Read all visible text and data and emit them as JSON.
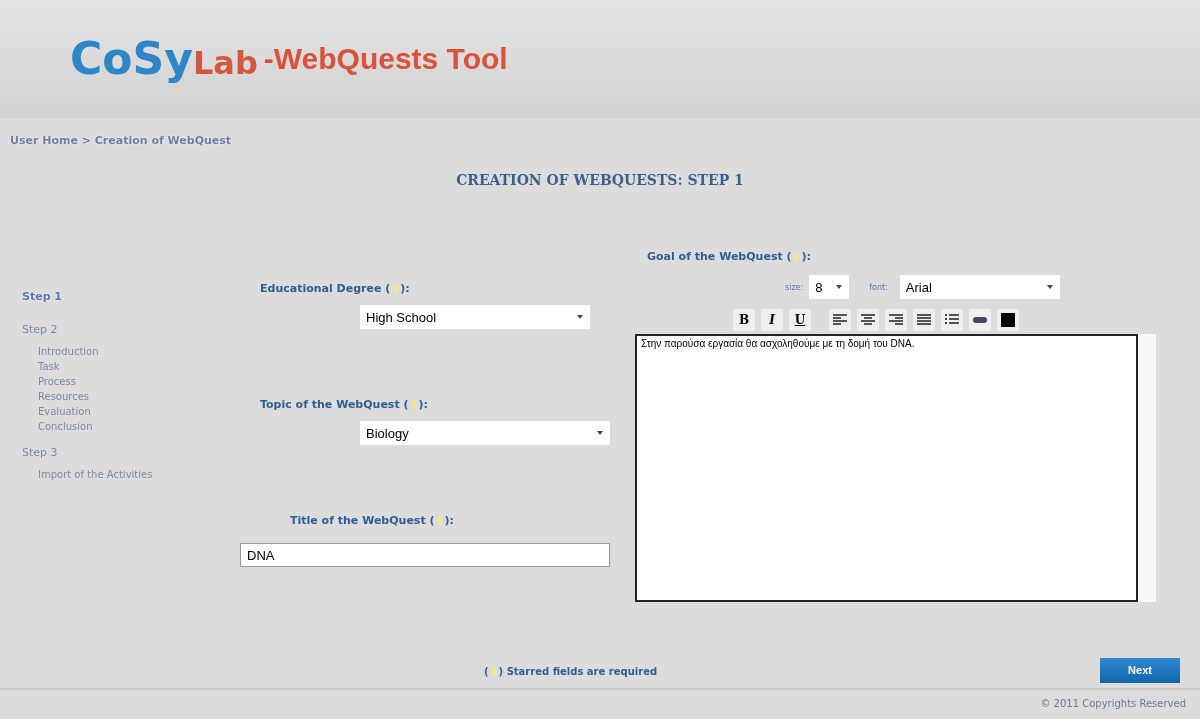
{
  "header": {
    "logo_parts": [
      "CoSy",
      "Lab"
    ],
    "title": "-WebQuests Tool"
  },
  "breadcrumb": "User Home > Creation of WebQuest",
  "heading": "CREATION OF WEBQUESTS: STEP 1",
  "sidebar": {
    "items": [
      {
        "label": "Step 1",
        "selected": true
      },
      {
        "label": "Step 2",
        "selected": false,
        "children": [
          {
            "label": "Introduction"
          },
          {
            "label": "Task"
          },
          {
            "label": "Process"
          },
          {
            "label": "Resources"
          },
          {
            "label": "Evaluation"
          },
          {
            "label": "Conclusion"
          }
        ]
      },
      {
        "label": "Step 3",
        "selected": false,
        "children": [
          {
            "label": "Import of the Activities"
          }
        ]
      }
    ]
  },
  "form": {
    "fields": [
      {
        "kind": "select",
        "label_start": "Educational Degree (",
        "label_end": "):",
        "value": "High School"
      },
      {
        "kind": "select",
        "label_start": "Topic of the WebQuest (",
        "label_end": "):",
        "value": "Biology"
      },
      {
        "kind": "text",
        "label_start": "Title of the WebQuest (",
        "label_end": "):",
        "value": "DNA"
      }
    ]
  },
  "goal": {
    "label_start": "Goal of the WebQuest (",
    "label_end": "):",
    "size_label": "size:",
    "size_value": "8",
    "font_label": "font:",
    "font_value": "Arial",
    "toolbar": [
      {
        "kind": "bold",
        "text": "B"
      },
      {
        "kind": "italic",
        "text": "I"
      },
      {
        "kind": "underline",
        "text": "U"
      },
      {
        "kind": "align-left"
      },
      {
        "kind": "align-center"
      },
      {
        "kind": "align-right"
      },
      {
        "kind": "justify"
      },
      {
        "kind": "list"
      },
      {
        "kind": "link"
      },
      {
        "kind": "color"
      }
    ],
    "text": "Στην παρούσα εργασία θα ασχοληθούμε με τη δομή του DNA."
  },
  "required_note_start": "(",
  "required_note_end": ") Starred fields are required",
  "next_button": "Next",
  "footer": "© 2011 Copyrights Reserved"
}
